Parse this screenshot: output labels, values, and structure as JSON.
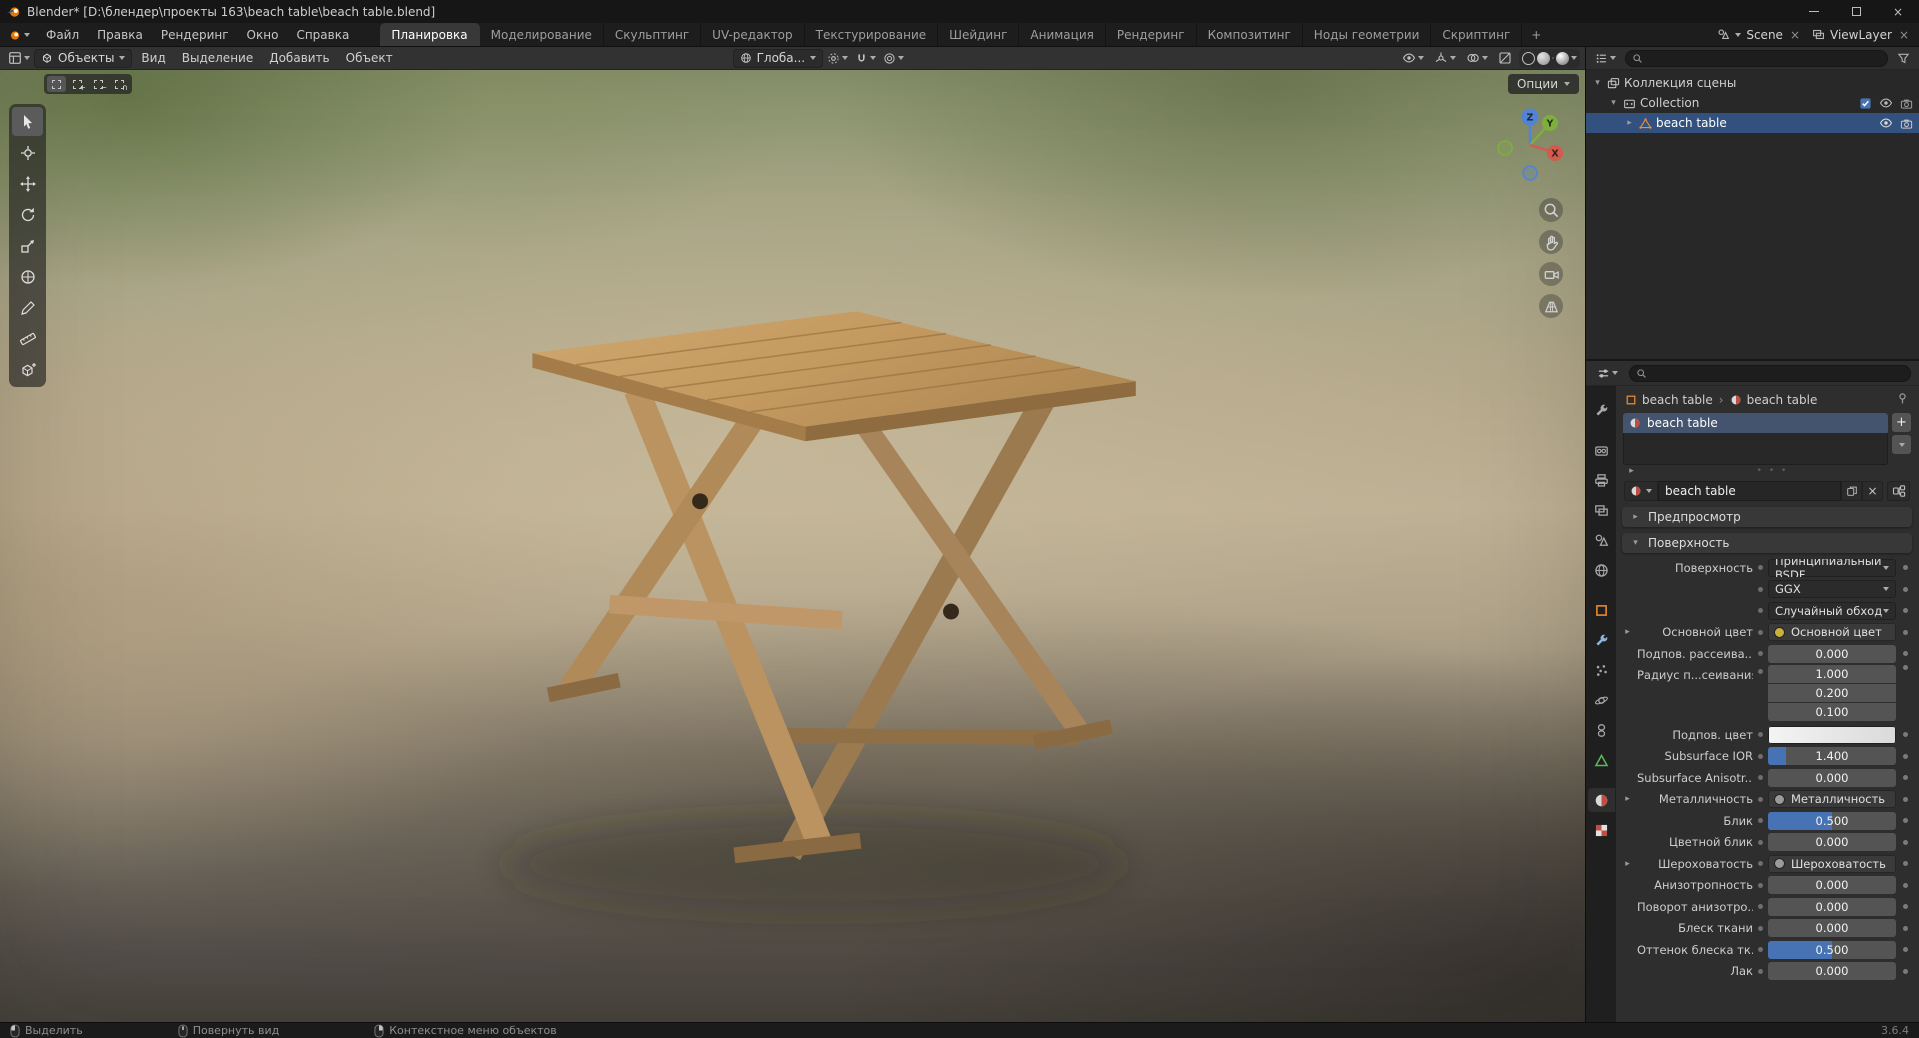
{
  "window": {
    "title": "Blender* [D:\\блендер\\проекты 163\\beach table\\beach table.blend]"
  },
  "topbar": {
    "app_menus": [
      "Файл",
      "Правка",
      "Рендеринг",
      "Окно",
      "Справка"
    ],
    "workspaces": [
      "Планировка",
      "Моделирование",
      "Скульптинг",
      "UV-редактор",
      "Текстурирование",
      "Шейдинг",
      "Анимация",
      "Рендеринг",
      "Композитинг",
      "Ноды геометрии",
      "Скриптинг"
    ],
    "active_workspace": "Планировка",
    "add_workspace_label": "+",
    "scene_label": "Scene",
    "viewlayer_label": "ViewLayer"
  },
  "viewport": {
    "mode_label": "Объекты",
    "menus": [
      "Вид",
      "Выделение",
      "Добавить",
      "Объект"
    ],
    "orientation_label": "Глоба...",
    "options_label": "Опции",
    "gizmo_axes": {
      "z": "Z",
      "y": "Y",
      "x": "X"
    }
  },
  "outliner": {
    "rows": [
      {
        "label": "Коллекция сцены"
      },
      {
        "label": "Collection"
      },
      {
        "label": "beach table"
      }
    ]
  },
  "properties": {
    "tabs": [
      "tool",
      "render",
      "output",
      "view-layer",
      "scene",
      "world",
      "object",
      "modifiers",
      "particles",
      "physics",
      "constraints",
      "data",
      "material",
      "texture"
    ],
    "active_tab": "material",
    "breadcrumb": {
      "object": "beach table",
      "material": "beach table"
    },
    "slots": [
      {
        "name": "beach table",
        "selected": true
      }
    ],
    "material_name": "beach table",
    "panels": {
      "preview": "Предпросмотр",
      "surface": "Поверхность"
    },
    "surface_rows": [
      {
        "key": "surface",
        "label": "Поверхность",
        "type": "dropdown",
        "value": "Принципиальный BSDF"
      },
      {
        "key": "distribution",
        "label": "",
        "type": "dropdown",
        "value": "GGX"
      },
      {
        "key": "subsurface-method",
        "label": "",
        "type": "dropdown",
        "value": "Случайный обход"
      },
      {
        "key": "base-color",
        "label": "Основной цвет",
        "type": "socket",
        "value": "Основной цвет",
        "dot": "#c9b23a",
        "expander": true
      },
      {
        "key": "subsurface",
        "label": "Подпов. рассеива...",
        "type": "number",
        "value": "0.000"
      },
      {
        "key": "subsurface-radius",
        "label": "Радиус п...сеивания",
        "type": "vector",
        "values": [
          "1.000",
          "0.200",
          "0.100"
        ]
      },
      {
        "key": "subsurface-color",
        "label": "Подпов. цвет",
        "type": "color"
      },
      {
        "key": "subsurface-ior",
        "label": "Subsurface IOR",
        "type": "slider",
        "value": "1.400",
        "fill": 0.14
      },
      {
        "key": "subsurface-anisotropy",
        "label": "Subsurface Anisotr...",
        "type": "number",
        "value": "0.000"
      },
      {
        "key": "metallic",
        "label": "Металличность",
        "type": "socket",
        "value": "Металличность",
        "dot": "#9a9a9a",
        "expander": true
      },
      {
        "key": "specular",
        "label": "Блик",
        "type": "slider",
        "value": "0.500",
        "fill": 0.5
      },
      {
        "key": "specular-tint",
        "label": "Цветной блик",
        "type": "number",
        "value": "0.000"
      },
      {
        "key": "roughness",
        "label": "Шероховатость",
        "type": "socket",
        "value": "Шероховатость",
        "dot": "#9a9a9a",
        "expander": true
      },
      {
        "key": "anisotropic",
        "label": "Анизотропность",
        "type": "number",
        "value": "0.000"
      },
      {
        "key": "anisotropic-rotation",
        "label": "Поворот анизотро...",
        "type": "number",
        "value": "0.000"
      },
      {
        "key": "sheen",
        "label": "Блеск ткани",
        "type": "number",
        "value": "0.000"
      },
      {
        "key": "sheen-tint",
        "label": "Оттенок блеска тк...",
        "type": "slider",
        "value": "0.500",
        "fill": 0.5
      },
      {
        "key": "clearcoat",
        "label": "Лак",
        "type": "number",
        "value": "0.000"
      }
    ]
  },
  "statusbar": {
    "hints": [
      {
        "label": "Выделить",
        "button": "left"
      },
      {
        "label": "Повернуть вид",
        "button": "middle"
      },
      {
        "label": "Контекстное меню объектов",
        "button": "right"
      }
    ],
    "version": "3.6.4"
  },
  "colors": {
    "accent": "#4772b3",
    "selection": "#33517e",
    "object_orange": "#e8882e"
  },
  "icons": [
    "blender-logo",
    "search-icon",
    "filter-icon",
    "eye-icon",
    "camera-icon",
    "checkbox-icon",
    "magnet-icon",
    "pin-icon",
    "nodes-icon",
    "navigation-gizmo",
    "zoom-icon",
    "hand-icon",
    "view-camera-icon",
    "grid-icon"
  ]
}
